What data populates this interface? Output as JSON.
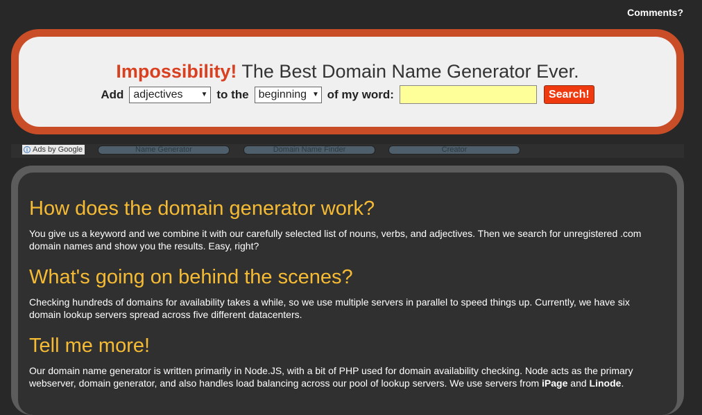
{
  "header": {
    "comments_link": "Comments?"
  },
  "hero": {
    "brand": "Impossibility!",
    "tagline": "The Best Domain Name Generator Ever.",
    "form": {
      "add_label": "Add",
      "word_type_value": "adjectives",
      "to_the_label": "to the",
      "position_value": "beginning",
      "of_my_word_label": "of my word:",
      "word_value": "",
      "search_label": "Search!"
    }
  },
  "adbar": {
    "ads_by_google": "Ads by Google",
    "links": [
      "Name Generator",
      "Domain Name Finder",
      "Creator"
    ]
  },
  "sections": [
    {
      "heading": "How does the domain generator work?",
      "body": "You give us a keyword and we combine it with our carefully selected list of nouns, verbs, and adjectives. Then we search for unregistered .com domain names and show you the results. Easy, right?"
    },
    {
      "heading": "What's going on behind the scenes?",
      "body": "Checking hundreds of domains for availability takes a while, so we use multiple servers in parallel to speed things up. Currently, we have six domain lookup servers spread across five different datacenters."
    },
    {
      "heading": "Tell me more!",
      "body_part1": "Our domain name generator is written primarily in Node.JS, with a bit of PHP used for domain availability checking. Node acts as the primary webserver, domain generator, and also handles load balancing across our pool of lookup servers. We use servers from ",
      "link1": "iPage",
      "and": " and ",
      "link2": "Linode",
      "period": "."
    }
  ],
  "colors": {
    "background": "#282828",
    "hero_border": "#c94d27",
    "brand_red": "#d9401f",
    "heading_yellow": "#f6bb34",
    "input_yellow": "#ffff99",
    "search_button": "#ef3a10"
  }
}
